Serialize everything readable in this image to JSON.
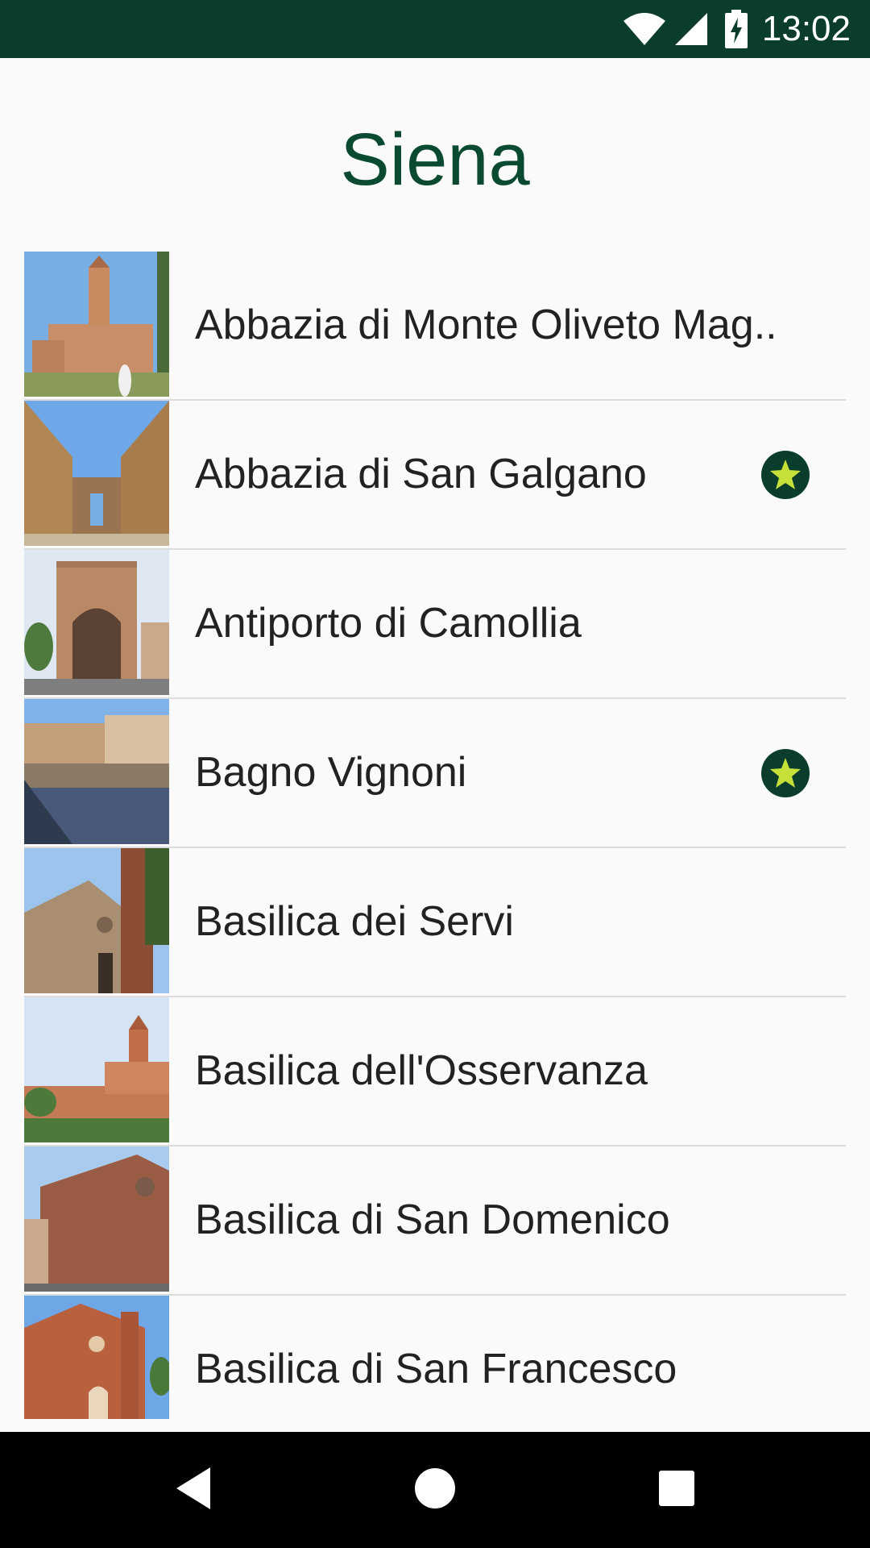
{
  "status_bar": {
    "time": "13:02",
    "icons": [
      "wifi-icon",
      "cell-signal-icon",
      "battery-charging-icon"
    ]
  },
  "title": "Siena",
  "items": [
    {
      "name": "Abbazia di Monte Oliveto Mag..",
      "favorite": false
    },
    {
      "name": "Abbazia di San Galgano",
      "favorite": true
    },
    {
      "name": "Antiporto di Camollia",
      "favorite": false
    },
    {
      "name": "Bagno Vignoni",
      "favorite": true
    },
    {
      "name": "Basilica dei Servi",
      "favorite": false
    },
    {
      "name": "Basilica dell'Osservanza",
      "favorite": false
    },
    {
      "name": "Basilica di San Domenico",
      "favorite": false
    },
    {
      "name": "Basilica di San Francesco",
      "favorite": false
    }
  ],
  "nav_bar": {
    "icons": [
      "back-icon",
      "home-icon",
      "recents-icon"
    ]
  },
  "colors": {
    "status_bar": "#0a3d2b",
    "title": "#0a4a30",
    "star_badge_bg": "#0a3d2b",
    "star_fill": "#c6e03a"
  }
}
